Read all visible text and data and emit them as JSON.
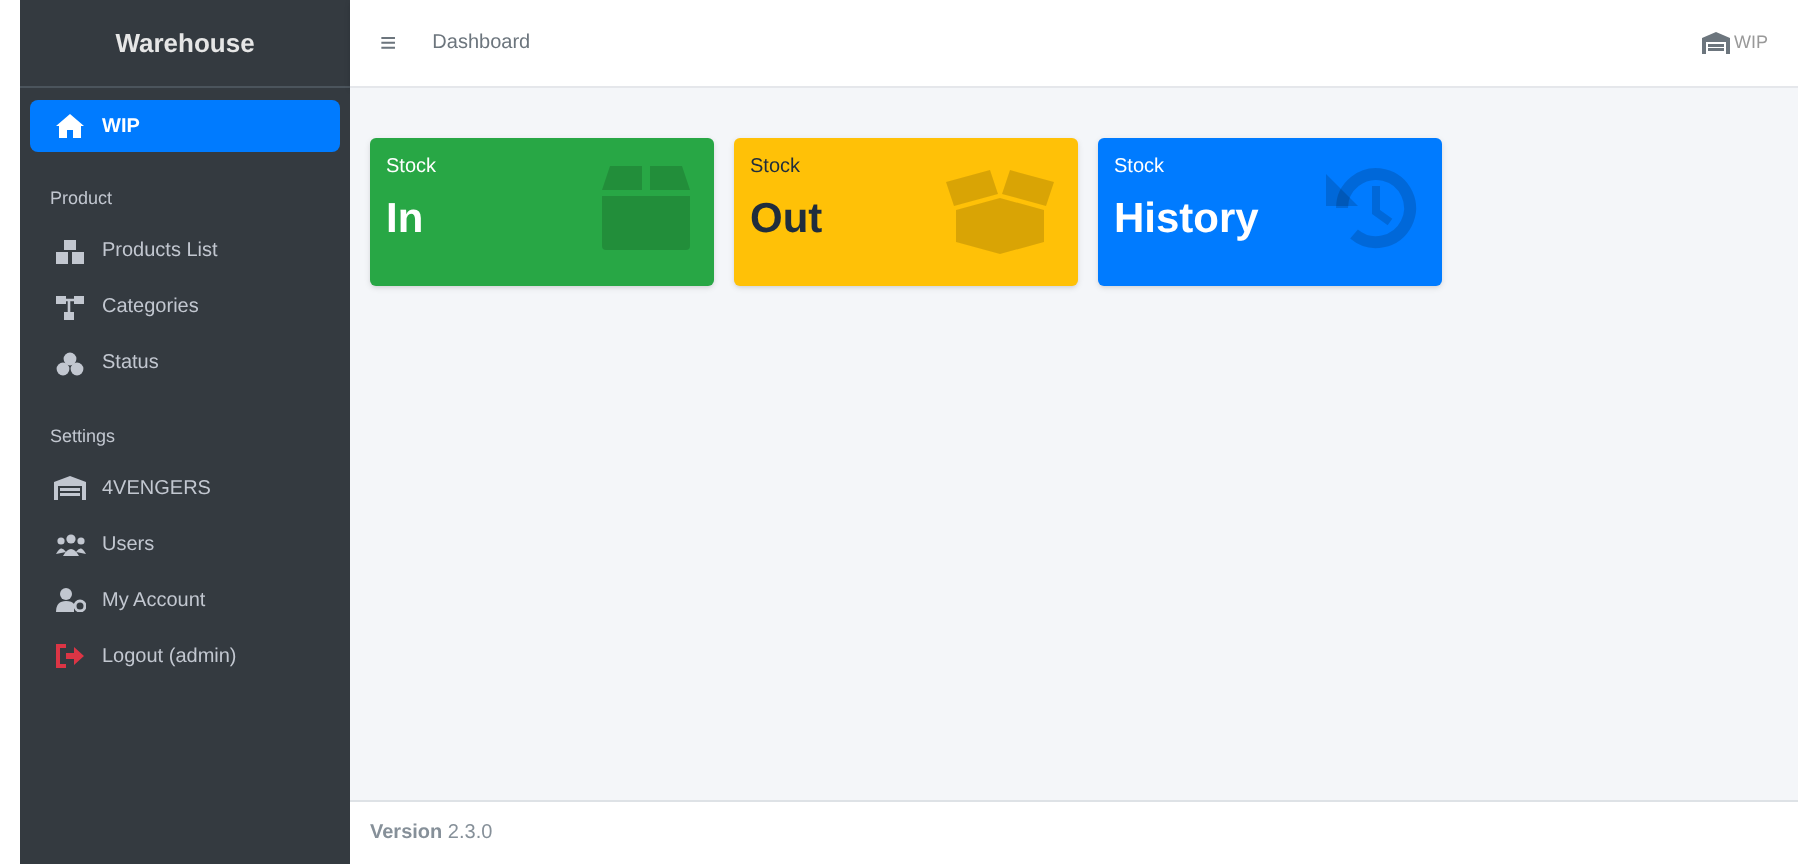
{
  "sidebar": {
    "brand": "Warehouse",
    "items": [
      {
        "label": "WIP",
        "selected": true,
        "kind": "link"
      }
    ],
    "sections": [
      {
        "title": "Product",
        "items": [
          {
            "label": "Products List",
            "selected": false,
            "kind": "link"
          },
          {
            "label": "Categories",
            "selected": false,
            "kind": "link"
          },
          {
            "label": "Status",
            "selected": false,
            "kind": "link"
          }
        ]
      },
      {
        "title": "Settings",
        "items": [
          {
            "label": "4VENGERS",
            "selected": false,
            "kind": "link"
          },
          {
            "label": "Users",
            "selected": false,
            "kind": "link"
          },
          {
            "label": "My Account",
            "selected": false,
            "kind": "link"
          },
          {
            "label": "Logout (admin)",
            "selected": false,
            "kind": "logout"
          }
        ]
      }
    ]
  },
  "header": {
    "breadcrumb": "Dashboard",
    "menu_icon": "≡",
    "warehouse": "WIP"
  },
  "cards": [
    {
      "caption": "Stock",
      "title": "In",
      "color": "#28a745"
    },
    {
      "caption": "Stock",
      "title": "Out",
      "color": "#ffc107"
    },
    {
      "caption": "Stock",
      "title": "History",
      "color": "#007bff"
    }
  ],
  "footer": {
    "version": "**Version** 2.3.0"
  }
}
